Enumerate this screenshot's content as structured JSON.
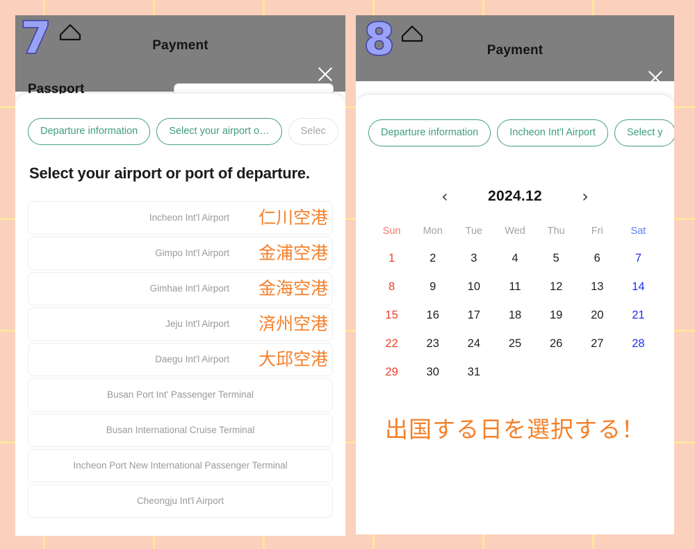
{
  "background": {
    "color": "#fbd0bd",
    "grid_line_color": "#ffeb96"
  },
  "left_panel": {
    "step_badge": "7",
    "home_icon": "home-icon",
    "header_title": "Payment",
    "close_icon": "close-icon",
    "background_form": {
      "label": "Passport"
    },
    "chips": [
      {
        "label": "Departure information",
        "state": "active"
      },
      {
        "label": "Select your airport o…",
        "state": "active"
      },
      {
        "label": "Selec",
        "state": "inactive"
      }
    ],
    "heading": "Select your airport or port of departure.",
    "airports": [
      {
        "en": "Incheon Int'l Airport",
        "jp": "仁川空港"
      },
      {
        "en": "Gimpo Int'l Airport",
        "jp": "金浦空港"
      },
      {
        "en": "Gimhae Int'l Airport",
        "jp": "金海空港"
      },
      {
        "en": "Jeju Int'l Airport",
        "jp": "済州空港"
      },
      {
        "en": "Daegu Int'l Airport",
        "jp": "大邱空港"
      },
      {
        "en": "Busan Port Int' Passenger Terminal",
        "jp": ""
      },
      {
        "en": "Busan International Cruise Terminal",
        "jp": ""
      },
      {
        "en": "Incheon Port New International Passenger Terminal",
        "jp": ""
      },
      {
        "en": "Cheongju Int'l Airport",
        "jp": ""
      }
    ]
  },
  "right_panel": {
    "step_badge": "8",
    "home_icon": "home-icon",
    "header_title": "Payment",
    "close_icon": "close-icon",
    "chips": [
      {
        "label": "Departure information",
        "state": "active"
      },
      {
        "label": "Incheon Int'l Airport",
        "state": "active"
      },
      {
        "label": "Select y",
        "state": "active"
      }
    ],
    "calendar": {
      "prev_label": "‹",
      "next_label": "›",
      "month": "2024.12",
      "weekdays": [
        "Sun",
        "Mon",
        "Tue",
        "Wed",
        "Thu",
        "Fri",
        "Sat"
      ],
      "weeks": [
        [
          "1",
          "2",
          "3",
          "4",
          "5",
          "6",
          "7"
        ],
        [
          "8",
          "9",
          "10",
          "11",
          "12",
          "13",
          "14"
        ],
        [
          "15",
          "16",
          "17",
          "18",
          "19",
          "20",
          "21"
        ],
        [
          "22",
          "23",
          "24",
          "25",
          "26",
          "27",
          "28"
        ],
        [
          "29",
          "30",
          "31",
          "",
          "",
          "",
          ""
        ]
      ],
      "sunday_color": "#e8402b",
      "saturday_color": "#1f30f0"
    },
    "caption": "出国する日を選択する！"
  },
  "annotation_color": "#f5802b"
}
